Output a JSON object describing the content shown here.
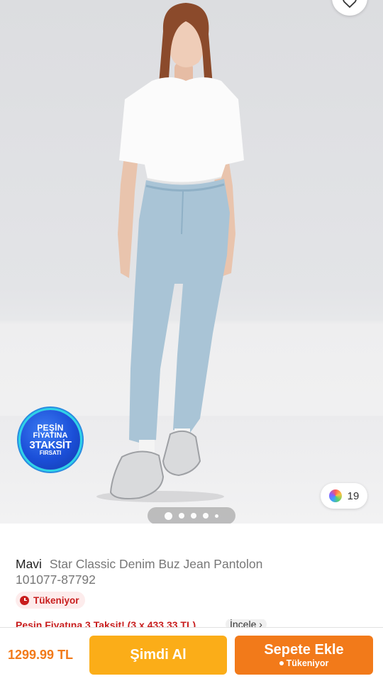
{
  "gallery": {
    "promo_badge": {
      "line1": "PEŞİN",
      "line2": "FİYATINA",
      "line3": "3TAKSİT",
      "line4": "FIRSATI"
    },
    "color_count": "19",
    "pages_total": 5,
    "page_active": 1,
    "favorite_icon": "heart-outline-icon",
    "colors": {
      "jean": "#a9c4d6",
      "shirt": "#fbfbfb",
      "background": "#dfe0e3"
    }
  },
  "product": {
    "brand": "Mavi",
    "name": "Star Classic Denim Buz Jean Pantolon",
    "sku": "101077-87792",
    "stock_badge": "Tükeniyor",
    "installment_text": "Peşin Fiyatına 3 Taksit! (3 x 433,33 TL)",
    "installment_link": "İncele",
    "chevron_icon": "chevron-right-icon"
  },
  "bottom_bar": {
    "price": "1299.99 TL",
    "buy_now_label": "Şimdi Al",
    "add_to_cart_label": "Sepete Ekle",
    "add_to_cart_sub": "Tükeniyor",
    "accent": "#f27a1a",
    "buy_color": "#fbad18"
  }
}
